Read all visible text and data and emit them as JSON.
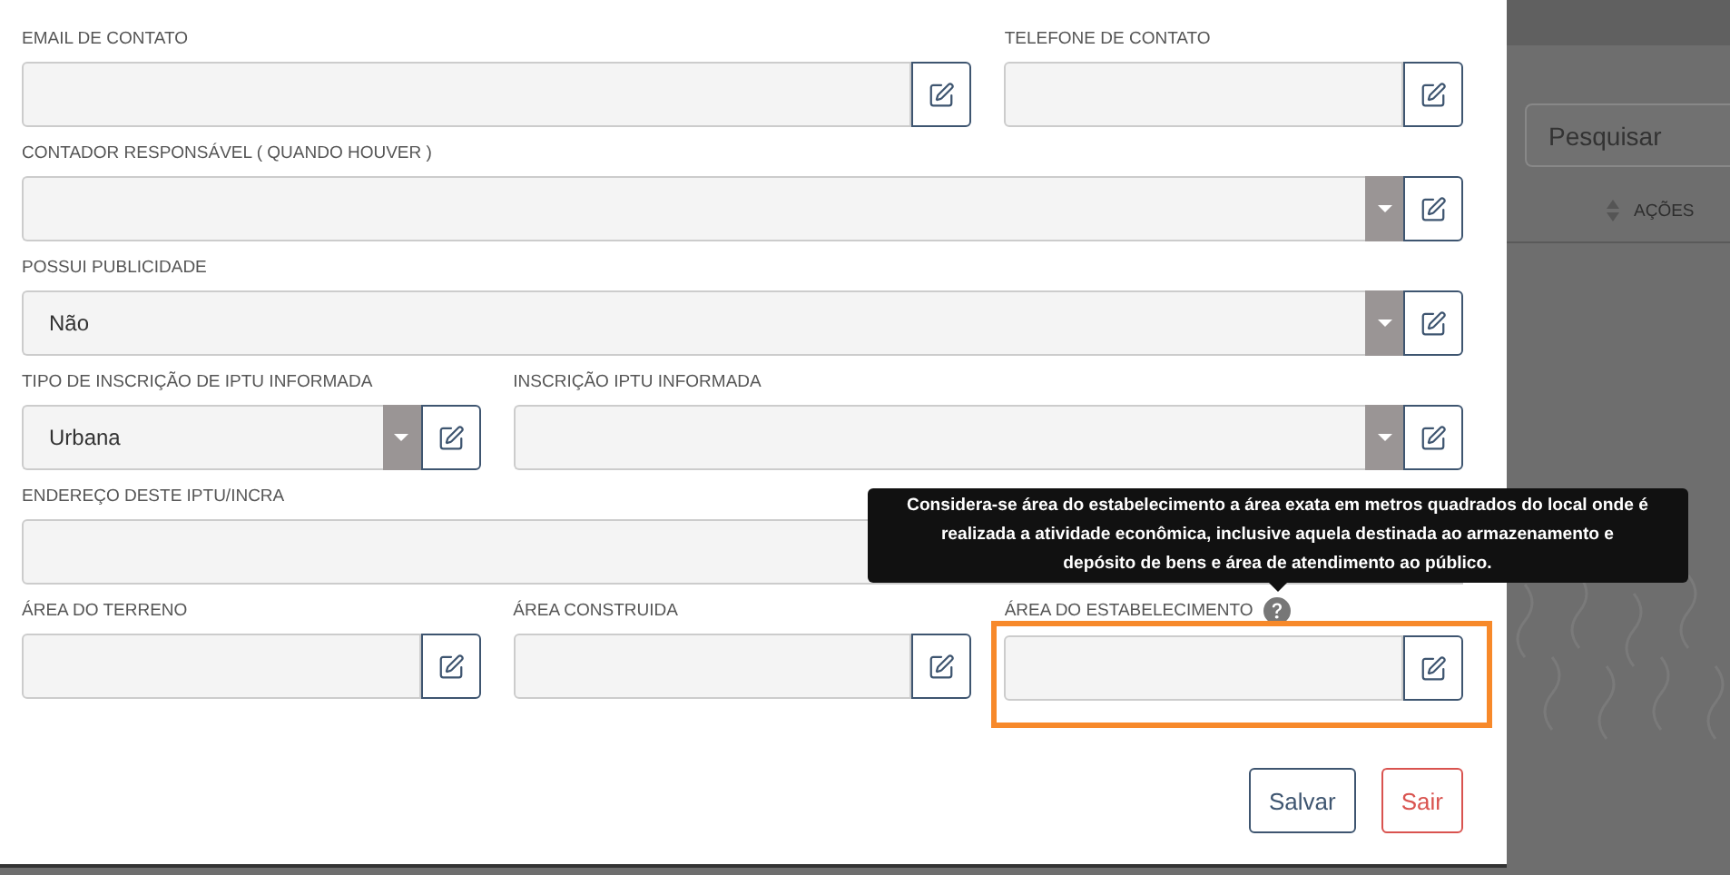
{
  "form": {
    "fields": [
      {
        "label": "EMAIL DE CONTATO",
        "kind": "text",
        "highlighted": false
      },
      {
        "label": "TELEFONE DE CONTATO",
        "kind": "text",
        "highlighted": false
      },
      {
        "label": "CONTADOR RESPONSÁVEL ( QUANDO HOUVER )",
        "kind": "select",
        "highlighted": false
      },
      {
        "label": "POSSUI PUBLICIDADE",
        "kind": "select",
        "value": "Não",
        "highlighted": false
      },
      {
        "label": "TIPO DE INSCRIÇÃO DE IPTU INFORMADA",
        "kind": "select",
        "value": "Urbana",
        "highlighted": false
      },
      {
        "label": "INSCRIÇÃO IPTU INFORMADA",
        "kind": "select",
        "highlighted": false
      },
      {
        "label": "ENDEREÇO DESTE IPTU/INCRA",
        "kind": "text",
        "highlighted": false,
        "covered_by_tooltip": true
      },
      {
        "label": "ÁREA DO TERRENO",
        "kind": "text",
        "highlighted": false
      },
      {
        "label": "ÁREA CONSTRUIDA",
        "kind": "text",
        "highlighted": false
      },
      {
        "label": "ÁREA DO ESTABELECIMENTO",
        "kind": "text",
        "highlighted": true,
        "tooltip": "Considera-se área do estabelecimento a área exata em metros quadrados do local onde é realizada a atividade econômica, inclusive aquela destinada ao armazenamento e depósito de bens e área de atendimento ao público."
      }
    ],
    "buttons": [
      {
        "label": "Salvar",
        "kind": "default"
      },
      {
        "label": "Sair",
        "kind": "danger"
      }
    ]
  },
  "background_page": {
    "search": {
      "placeholder": "Pesquisar"
    },
    "table": {
      "columns": [
        "AÇÕES"
      ]
    }
  }
}
